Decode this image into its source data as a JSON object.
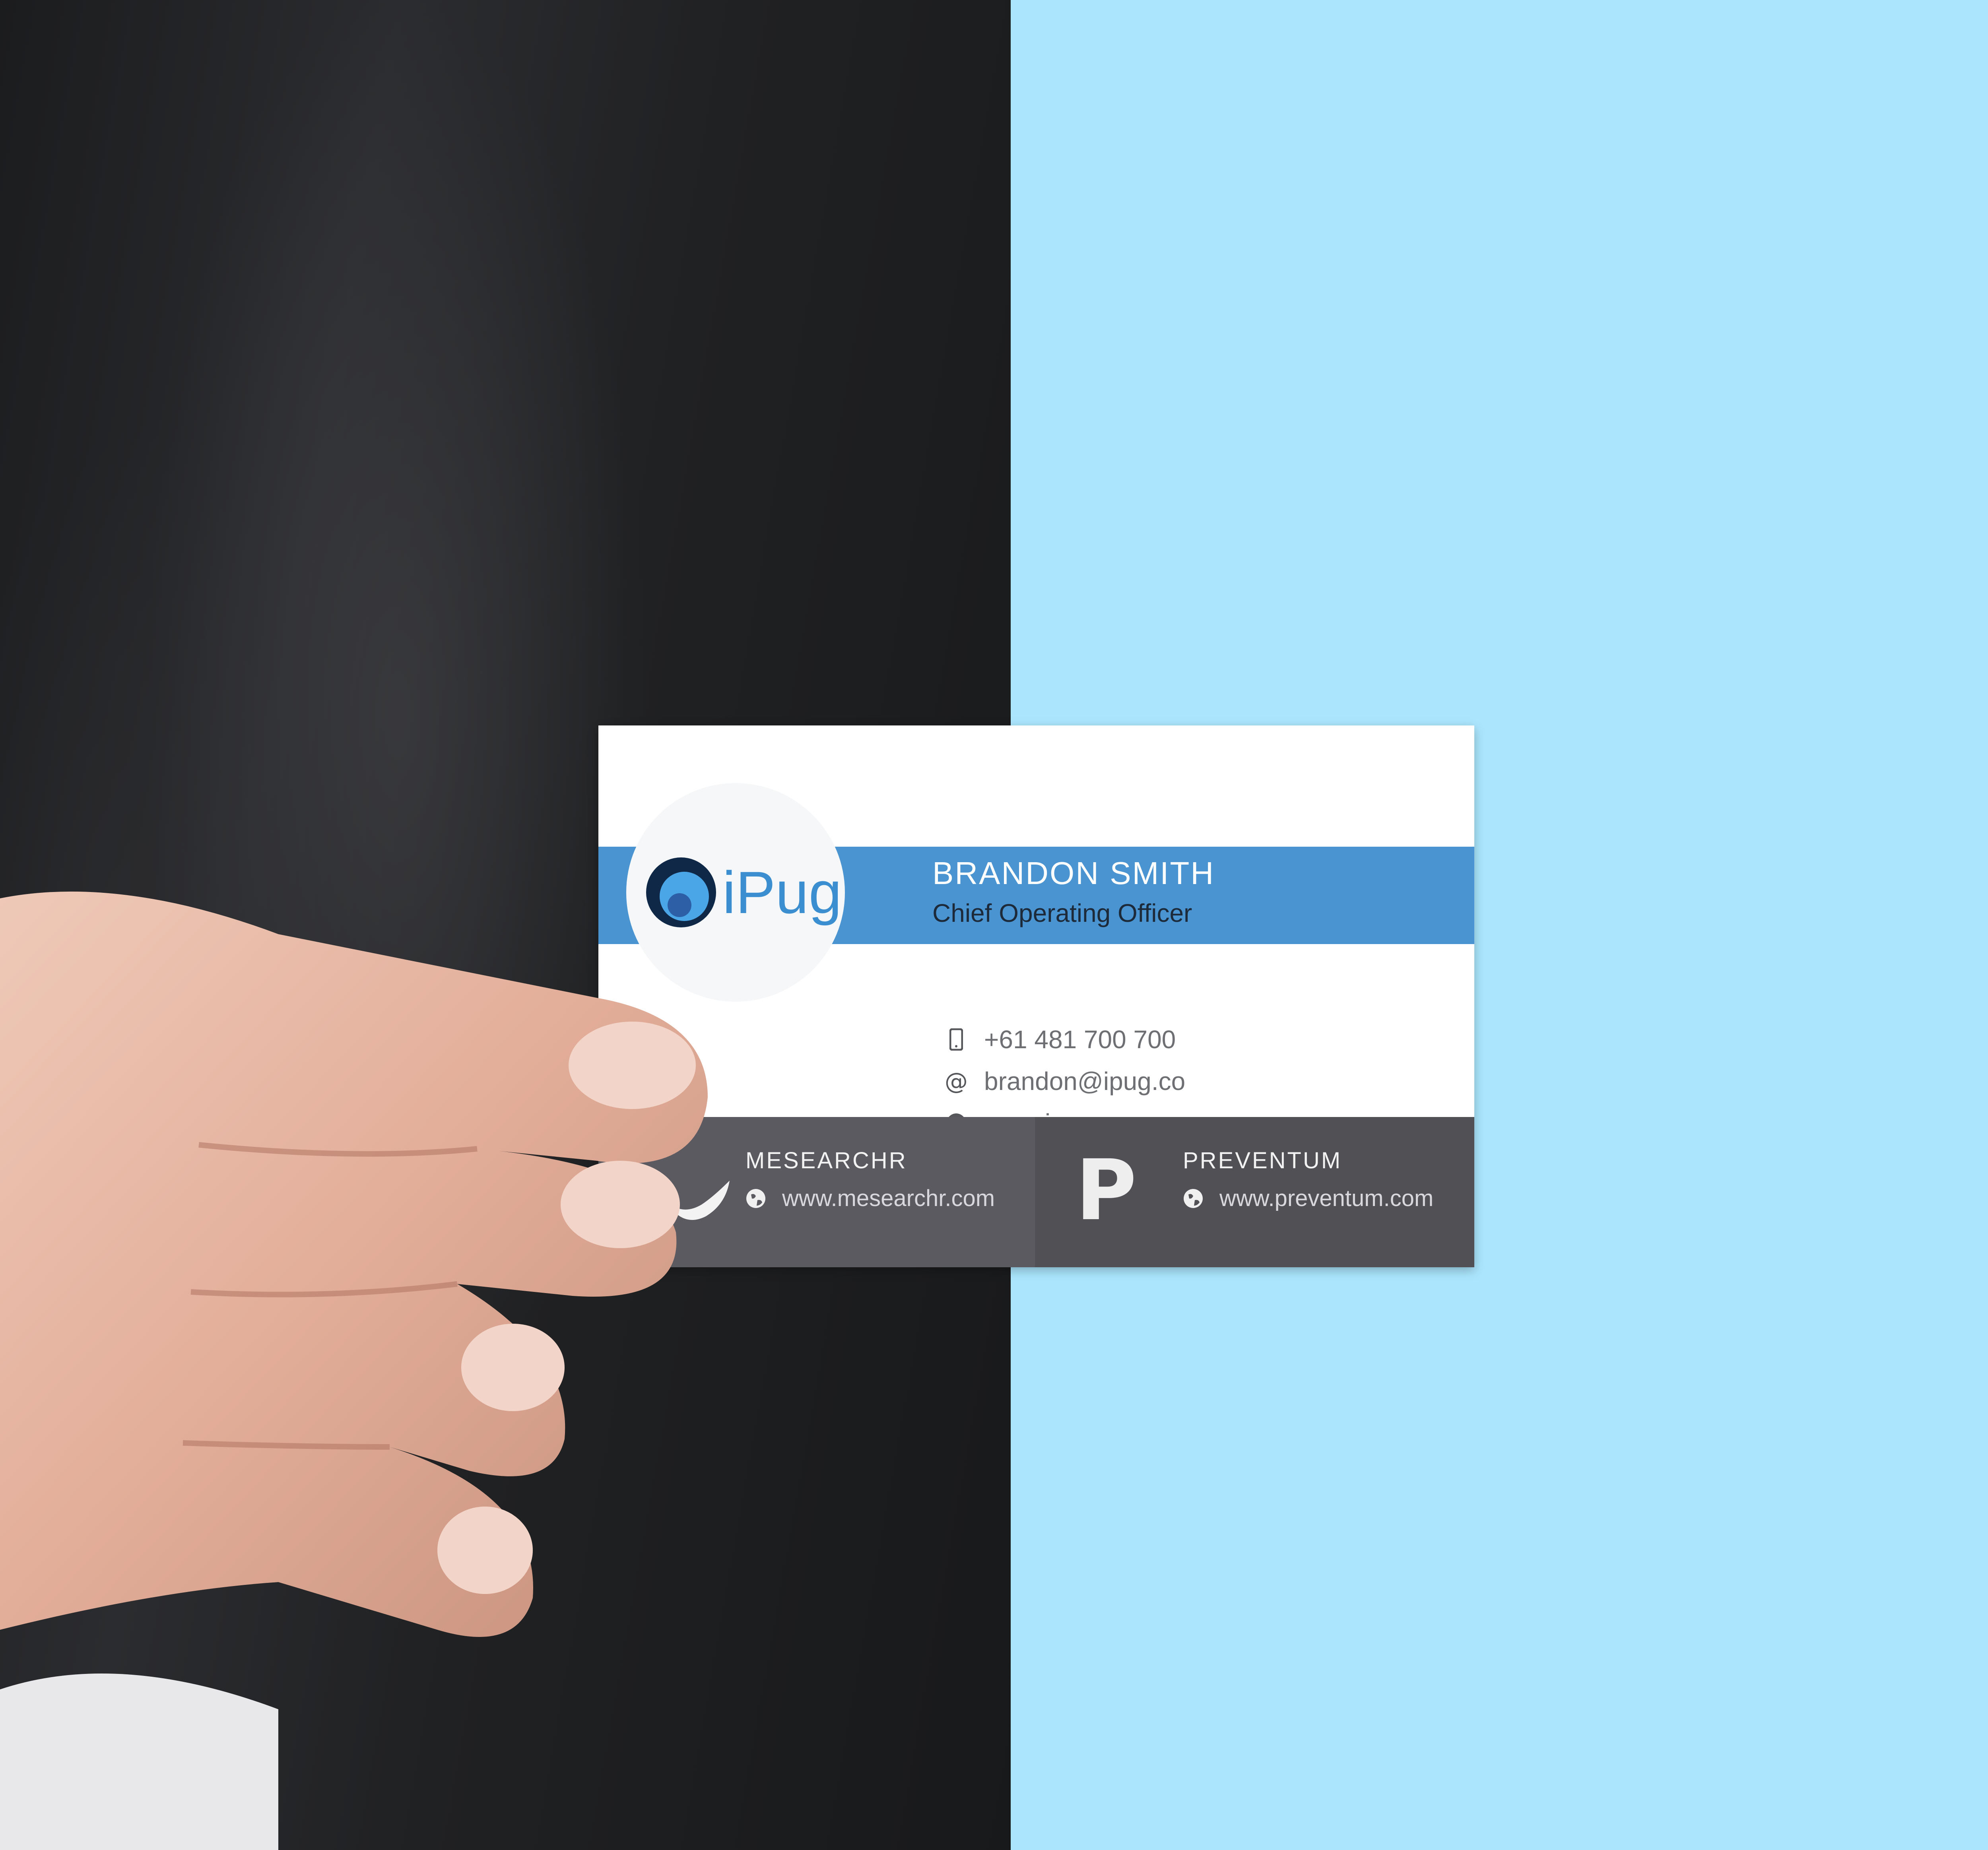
{
  "colors": {
    "background_right": "#abe5fd",
    "background_left": "#1f2023",
    "card_accent": "#4a94d2",
    "card_footer": "#5b5a61",
    "logo_blue": "#3b8fd1"
  },
  "card": {
    "logo": {
      "text": "iPug",
      "icon": "ipug-logo-icon"
    },
    "name": "BRANDON SMITH",
    "job_title": "Chief Operating Officer",
    "contacts": [
      {
        "icon": "phone-icon",
        "text": "+61 481 700 700"
      },
      {
        "icon": "at-icon",
        "text": "brandon@ipug.co"
      },
      {
        "icon": "globe-icon",
        "text": "www.ipug.co"
      }
    ],
    "footer": [
      {
        "name": "MESEARCHR",
        "icon": "globe-icon",
        "url": "www.mesearchr.com",
        "logo_icon": "mesearchr-logo-icon"
      },
      {
        "name": "PREVENTUM",
        "icon": "globe-icon",
        "url": "www.preventum.com",
        "logo_letter": "P"
      }
    ]
  }
}
